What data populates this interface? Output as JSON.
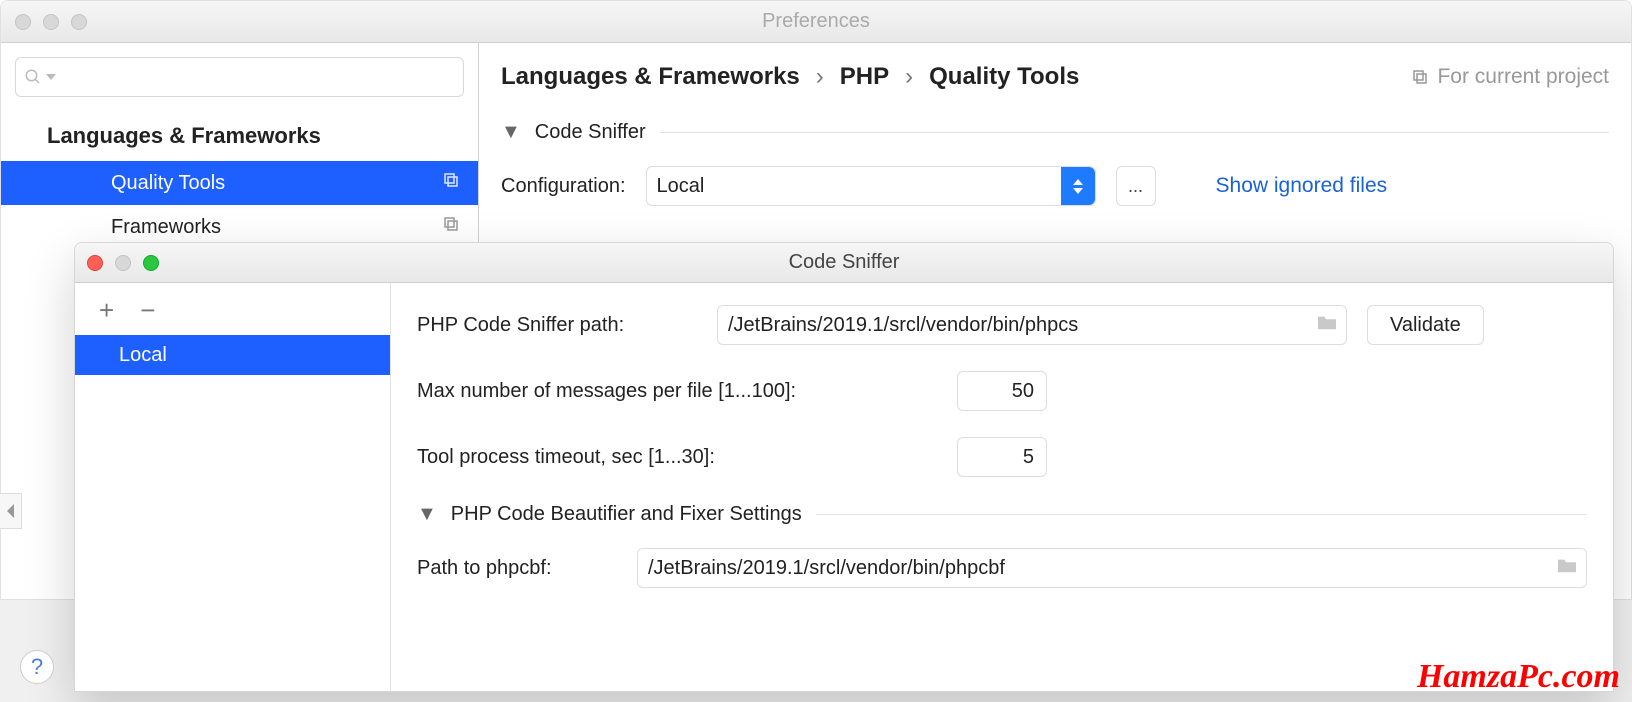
{
  "window": {
    "title": "Preferences"
  },
  "sidebar": {
    "category": "Languages & Frameworks",
    "items": [
      {
        "label": "Quality Tools",
        "selected": true
      },
      {
        "label": "Frameworks",
        "selected": false
      }
    ]
  },
  "breadcrumb": {
    "parts": [
      "Languages & Frameworks",
      "PHP",
      "Quality Tools"
    ],
    "for_current": "For current project"
  },
  "main": {
    "section1": "Code Sniffer",
    "config_label": "Configuration:",
    "config_value": "Local",
    "ellipsis": "...",
    "show_ignored": "Show ignored files"
  },
  "dialog": {
    "title": "Code Sniffer",
    "list": [
      "Local"
    ],
    "rows": {
      "path_label": "PHP Code Sniffer path:",
      "path_value": "/JetBrains/2019.1/srcl/vendor/bin/phpcs",
      "validate": "Validate",
      "max_label": "Max number of messages per file [1...100]:",
      "max_value": "50",
      "timeout_label": "Tool process timeout, sec [1...30]:",
      "timeout_value": "5",
      "section2": "PHP Code Beautifier and Fixer Settings",
      "phpcbf_label": "Path to phpcbf:",
      "phpcbf_value": "/JetBrains/2019.1/srcl/vendor/bin/phpcbf"
    }
  },
  "watermark": "HamzaPc.com"
}
